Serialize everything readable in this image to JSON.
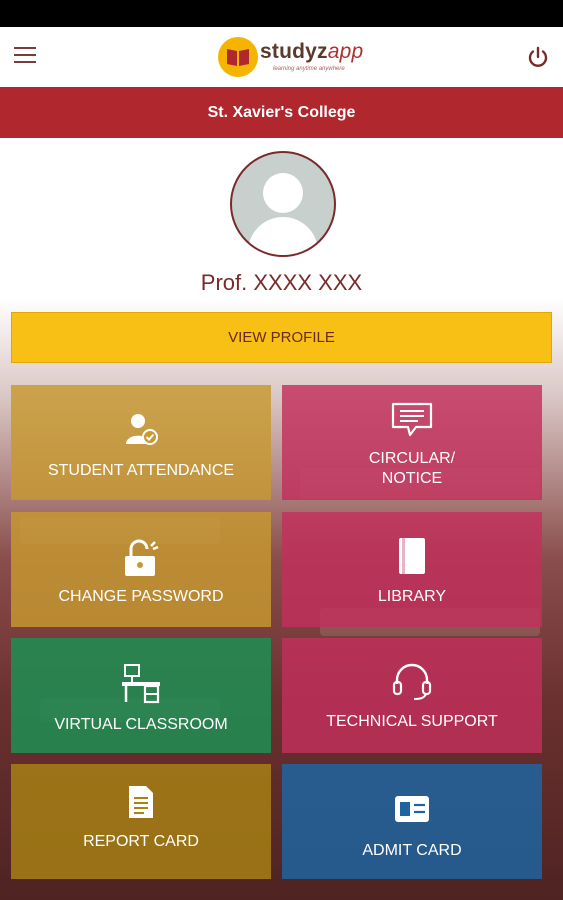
{
  "app": {
    "brand_main": "studyz",
    "brand_accent": "app",
    "tagline": "learning anytime anywhere"
  },
  "header": {
    "college_name": "St. Xavier's College"
  },
  "profile": {
    "name": "Prof.  XXXX   XXX",
    "view_profile_label": "VIEW PROFILE"
  },
  "tiles": [
    {
      "label": "STUDENT  ATTENDANCE",
      "icon": "user-check-icon",
      "color": "#c79930"
    },
    {
      "label_line1": "CIRCULAR/",
      "label_line2": "NOTICE",
      "icon": "speech-bubble-icon",
      "color": "#c2305c"
    },
    {
      "label": "CHANGE PASSWORD",
      "icon": "unlock-icon",
      "color": "#c79930"
    },
    {
      "label": "LIBRARY",
      "icon": "book-icon",
      "color": "#c2305c"
    },
    {
      "label": "VIRTUAL CLASSROOM",
      "icon": "desk-icon",
      "color": "#208c52"
    },
    {
      "label": "TECHNICAL SUPPORT",
      "icon": "headset-icon",
      "color": "#c2305c"
    },
    {
      "label": "REPORT CARD",
      "icon": "document-icon",
      "color": "#aa8214"
    },
    {
      "label": "ADMIT CARD",
      "icon": "id-card-icon",
      "color": "#1e64a0"
    }
  ],
  "colors": {
    "primary": "#b0272e",
    "accent": "#f8bf14"
  }
}
